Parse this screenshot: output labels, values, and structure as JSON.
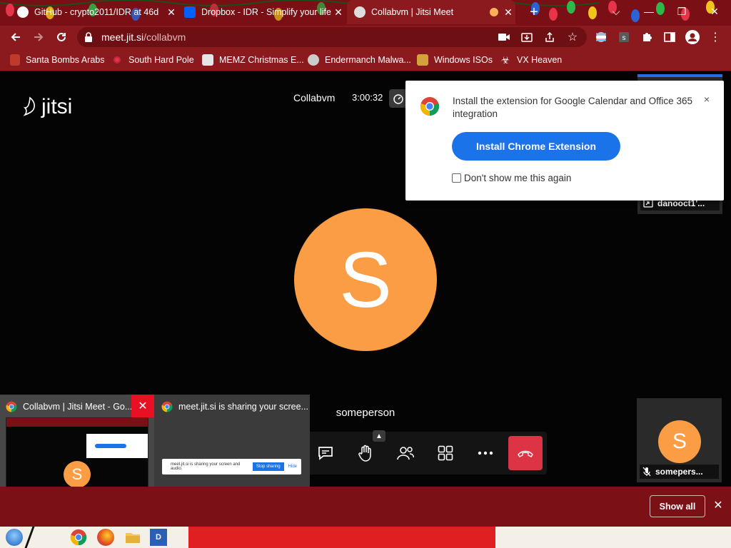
{
  "tabs": [
    {
      "title": "GitHub - crypto2011/IDR at 46d",
      "close": "✕"
    },
    {
      "title": "Dropbox - IDR - Simplify your life",
      "close": "✕"
    },
    {
      "title": "Collabvm | Jitsi Meet",
      "close": "✕"
    }
  ],
  "window_controls": {
    "chevron": "⌵",
    "minimize": "—",
    "restore": "❐",
    "close": "✕"
  },
  "omnibox": {
    "host": "meet.jit.si",
    "path": "/collabvm"
  },
  "bookmarks": [
    {
      "label": "Santa Bombs Arabs",
      "icon": "santa-icon"
    },
    {
      "label": "South Hard Pole",
      "icon": "flower-icon"
    },
    {
      "label": "MEMZ Christmas E...",
      "icon": "memz-icon"
    },
    {
      "label": "Endermanch Malwa...",
      "icon": "skull-icon"
    },
    {
      "label": "Windows ISOs",
      "icon": "person-icon"
    },
    {
      "label": "VX Heaven",
      "icon": "biohazard-icon"
    }
  ],
  "meeting": {
    "logo_text": "jitsi",
    "title": "Collabvm",
    "timer": "3:00:32",
    "main_avatar_letter": "S",
    "main_participant_name": "someperson",
    "top_thumbnail_name": "danooct1'...",
    "bottom_thumbnail_name": "somepers...",
    "bottom_thumbnail_letter": "S"
  },
  "extension_popup": {
    "message": "Install the extension for Google Calendar and Office 365 integration",
    "install_label": "Install Chrome Extension",
    "dont_show_label": "Don't show me this again",
    "close": "×"
  },
  "taskbar_preview": {
    "window1_title": "Collabvm | Jitsi Meet - Go...",
    "window2_title": "meet.jit.si is sharing your scree...",
    "mini1_avatar_letter": "S",
    "mini2_text": "meet.jit.si is sharing your screen and audio.",
    "mini2_stop": "Stop sharing",
    "mini2_hide": "Hide"
  },
  "share_bar": {
    "show_all": "Show all",
    "close": "✕"
  },
  "colors": {
    "tab_strip": "#7a1015",
    "toolbar": "#8b1a1e",
    "avatar": "#fa9d44",
    "install_button": "#1a73e8",
    "hangup": "#dd3445",
    "dominant_speaker_border": "#246fe5"
  }
}
